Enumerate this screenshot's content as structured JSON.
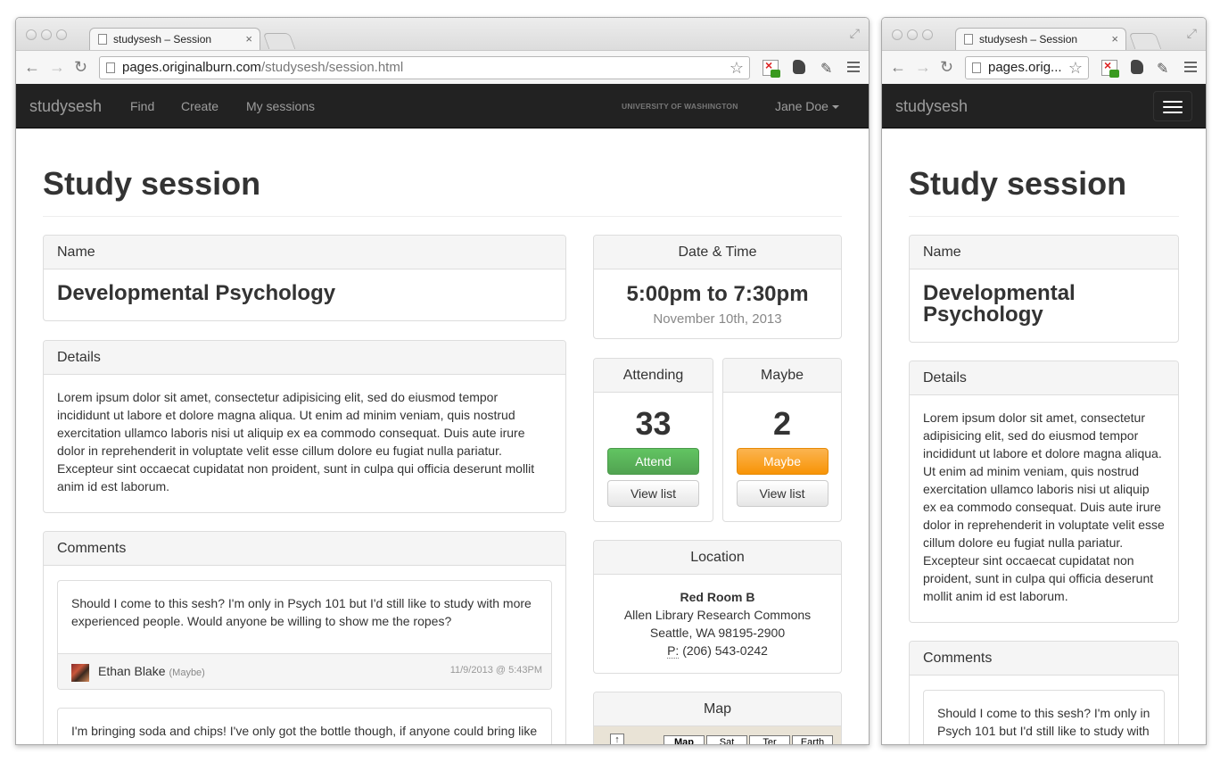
{
  "browser": {
    "tab_title": "studysesh – Session",
    "tab_close": "×",
    "url_host": "pages.originalburn.com",
    "url_path": "/studysesh/session.html",
    "url_truncated": "pages.orig...",
    "back": "←",
    "forward": "→",
    "reload": "↻",
    "star": "☆"
  },
  "navbar": {
    "brand": "studysesh",
    "links": [
      "Find",
      "Create",
      "My sessions"
    ],
    "school": "UNIVERSITY OF WASHINGTON",
    "user": "Jane Doe"
  },
  "page": {
    "title": "Study session",
    "name_heading": "Name",
    "session_name": "Developmental Psychology",
    "details_heading": "Details",
    "details_text": "Lorem ipsum dolor sit amet, consectetur adipisicing elit, sed do eiusmod tempor incididunt ut labore et dolore magna aliqua. Ut enim ad minim veniam, quis nostrud exercitation ullamco laboris nisi ut aliquip ex ea commodo consequat. Duis aute irure dolor in reprehenderit in voluptate velit esse cillum dolore eu fugiat nulla pariatur. Excepteur sint occaecat cupidatat non proident, sunt in culpa qui officia deserunt mollit anim id est laborum.",
    "comments_heading": "Comments"
  },
  "datetime": {
    "heading": "Date & Time",
    "time": "5:00pm to 7:30pm",
    "date": "November 10th, 2013"
  },
  "attending": {
    "heading": "Attending",
    "count": "33",
    "button": "Attend",
    "list_button": "View list"
  },
  "maybe": {
    "heading": "Maybe",
    "count": "2",
    "button": "Maybe",
    "list_button": "View list"
  },
  "location": {
    "heading": "Location",
    "room": "Red Room B",
    "building": "Allen Library Research Commons",
    "city": "Seattle, WA 98195-2900",
    "phone_label": "P:",
    "phone": "(206) 543-0242"
  },
  "map": {
    "heading": "Map",
    "zoom": "↑",
    "buttons": [
      "Map",
      "Sat",
      "Ter",
      "Earth"
    ]
  },
  "comments": [
    {
      "text": "Should I come to this sesh? I'm only in Psych 101 but I'd still like to study with more experienced people. Would anyone be willing to show me the ropes?",
      "author": "Ethan Blake",
      "rsvp": "(Maybe)",
      "time": "11/9/2013 @ 5:43PM"
    },
    {
      "text": "I'm bringing soda and chips! I've only got the bottle though, if anyone could bring like cups and napkins that would be a big awesome."
    }
  ]
}
